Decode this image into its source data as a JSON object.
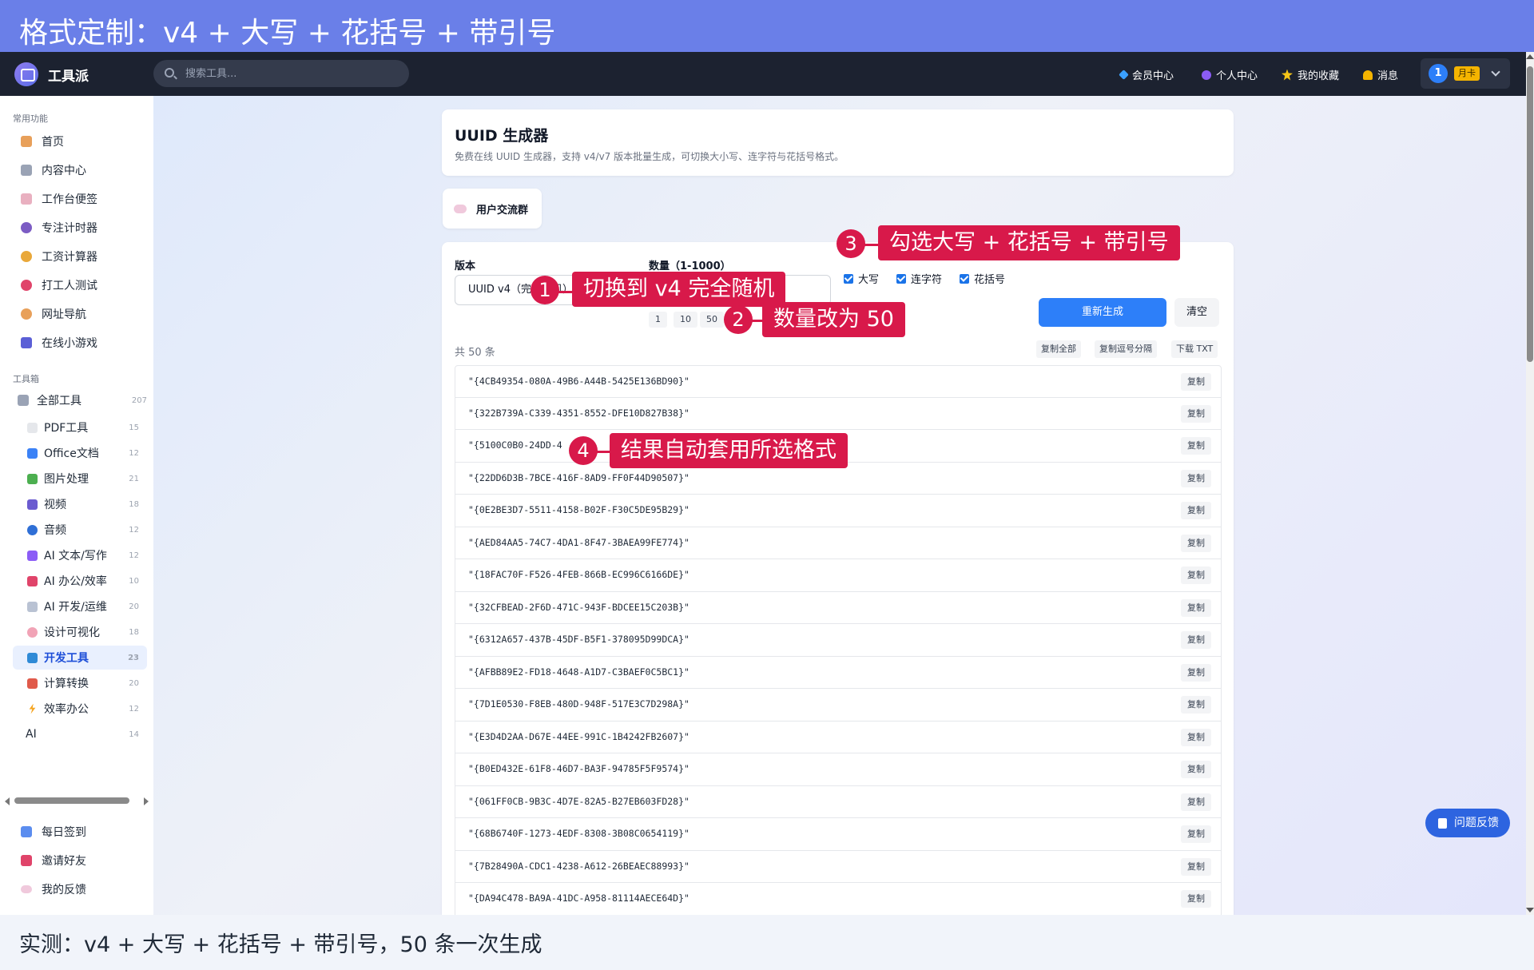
{
  "banner": {
    "title": "格式定制：v4 + 大写 + 花括号 + 带引号"
  },
  "header": {
    "logo_text": "工具派",
    "search_placeholder": "搜索工具...",
    "nav": [
      "会员中心",
      "个人中心",
      "我的收藏",
      "消息"
    ],
    "user": {
      "avatar": "1",
      "badge": "月卡"
    }
  },
  "sidebar": {
    "section_common": "常用功能",
    "common_items": [
      "首页",
      "内容中心",
      "工作台便签",
      "专注计时器",
      "工资计算器",
      "打工人测试",
      "网址导航",
      "在线小游戏"
    ],
    "section_tools": "工具箱",
    "all_tools": {
      "label": "全部工具",
      "count": "207"
    },
    "categories": [
      {
        "label": "PDF工具",
        "count": "15"
      },
      {
        "label": "Office文档",
        "count": "12"
      },
      {
        "label": "图片处理",
        "count": "21"
      },
      {
        "label": "视频",
        "count": "18"
      },
      {
        "label": "音频",
        "count": "12"
      },
      {
        "label": "AI 文本/写作",
        "count": "12"
      },
      {
        "label": "AI 办公/效率",
        "count": "10"
      },
      {
        "label": "AI 开发/运维",
        "count": "20"
      },
      {
        "label": "设计可视化",
        "count": "18"
      },
      {
        "label": "开发工具",
        "count": "23"
      },
      {
        "label": "计算转换",
        "count": "20"
      },
      {
        "label": "效率办公",
        "count": "12"
      },
      {
        "label": "AI",
        "count": "14"
      }
    ],
    "bottom_items": [
      "每日签到",
      "邀请好友",
      "我的反馈"
    ]
  },
  "page": {
    "title": "UUID 生成器",
    "desc": "免费在线 UUID 生成器，支持 v4/v7 版本批量生成，可切换大小写、连字符与花括号格式。",
    "group_btn": "用户交流群"
  },
  "form": {
    "version_label": "版本",
    "version_value": "UUID v4（完全随机）",
    "count_label": "数量（1-1000）",
    "count_value": "50",
    "presets": [
      "1",
      "10",
      "50"
    ],
    "checkboxes": [
      "大写",
      "连字符",
      "花括号"
    ],
    "regen": "重新生成",
    "clear": "清空"
  },
  "results": {
    "total": "共 50 条",
    "actions": [
      "复制全部",
      "复制逗号分隔",
      "下载 TXT"
    ],
    "copy_label": "复制",
    "items": [
      "\"{4CB49354-080A-49B6-A44B-5425E136BD90}\"",
      "\"{322B739A-C339-4351-8552-DFE10D827B38}\"",
      "\"{5100C0B0-24DD-4",
      "\"{22DD6D3B-7BCE-416F-8AD9-FF0F44D90507}\"",
      "\"{0E2BE3D7-5511-4158-B02F-F30C5DE95B29}\"",
      "\"{AED84AA5-74C7-4DA1-8F47-3BAEA99FE774}\"",
      "\"{18FAC70F-F526-4FEB-866B-EC996C6166DE}\"",
      "\"{32CFBEAD-2F6D-471C-943F-BDCEE15C203B}\"",
      "\"{6312A657-437B-45DF-B5F1-378095D99DCA}\"",
      "\"{AFBB89E2-FD18-4648-A1D7-C3BAEF0C5BC1}\"",
      "\"{7D1E0530-F8EB-480D-948F-517E3C7D298A}\"",
      "\"{E3D4D2AA-D67E-44EE-991C-1B4242FB2607}\"",
      "\"{B0ED432E-61F8-46D7-BA3F-94785F5F9574}\"",
      "\"{061FF0CB-9B3C-4D7E-82A5-B27EB603FD28}\"",
      "\"{68B6740F-1273-4EDF-8308-3B08C0654119}\"",
      "\"{7B28490A-CDC1-4238-A612-26BEAEC88993}\"",
      "\"{DA94C478-BA9A-41DC-A958-81114AECE64D}\""
    ]
  },
  "annotations": [
    {
      "num": "1",
      "text": "切换到 v4 完全随机"
    },
    {
      "num": "2",
      "text": "数量改为 50"
    },
    {
      "num": "3",
      "text": "勾选大写 + 花括号 + 带引号"
    },
    {
      "num": "4",
      "text": "结果自动套用所选格式"
    }
  ],
  "feedback": "问题反馈",
  "caption": "实测：v4 + 大写 + 花括号 + 带引号，50 条一次生成",
  "colors": {
    "accent": "#2d7ff9",
    "annotation": "#d8194a",
    "banner": "#6a7fe8",
    "appbar": "#1c2230"
  }
}
